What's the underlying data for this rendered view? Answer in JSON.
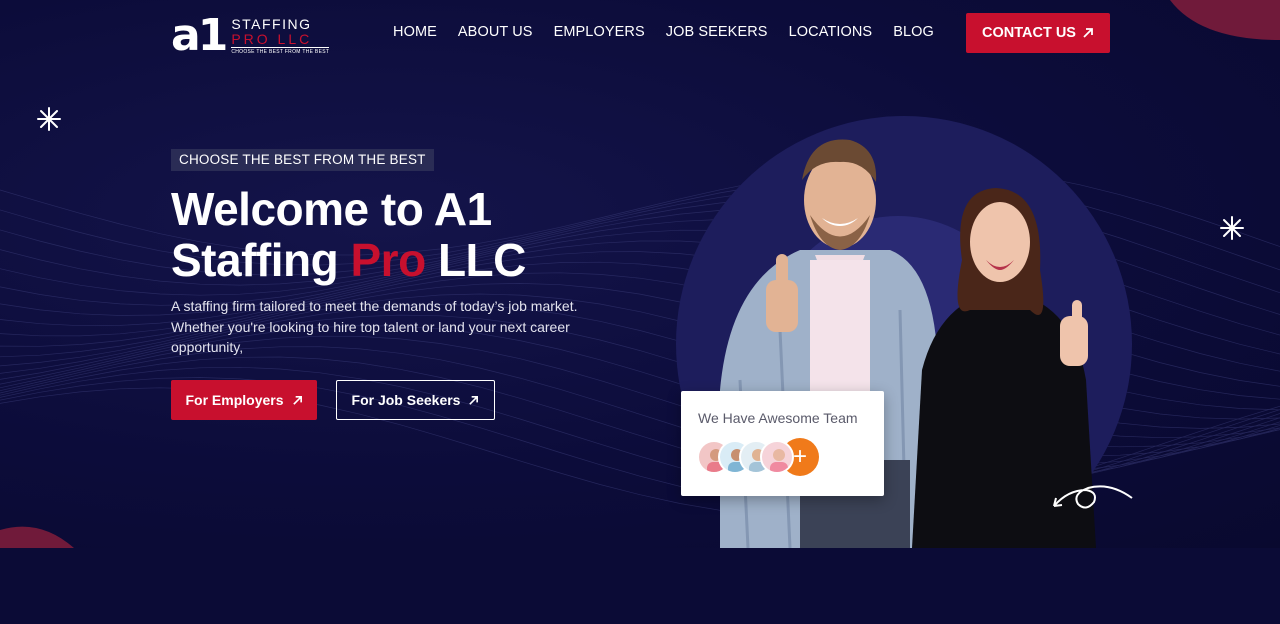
{
  "header": {
    "logo": {
      "mark": "a1",
      "line1": "STAFFING",
      "line2": "PRO LLC",
      "tagline": "CHOOSE THE BEST FROM THE BEST"
    },
    "nav": [
      {
        "label": "HOME",
        "name": "nav-home"
      },
      {
        "label": "ABOUT US",
        "name": "nav-about-us"
      },
      {
        "label": "EMPLOYERS",
        "name": "nav-employers"
      },
      {
        "label": "JOB SEEKERS",
        "name": "nav-job-seekers"
      },
      {
        "label": "LOCATIONS",
        "name": "nav-locations"
      },
      {
        "label": "BLOG",
        "name": "nav-blog"
      }
    ],
    "contact_label": "CONTACT US"
  },
  "hero": {
    "tag": "CHOOSE THE BEST FROM THE BEST",
    "headline_part1": "Welcome to A1",
    "headline_part2": "Staffing ",
    "headline_accent": "Pro",
    "headline_part3": " LLC",
    "description": "A staffing firm tailored to meet the demands of today’s job market. Whether you're looking to hire top talent or land your next career opportunity,",
    "btn_employers": "For Employers",
    "btn_job_seekers": "For Job Seekers"
  },
  "team_card": {
    "title": "We Have Awesome Team",
    "plus": "+"
  },
  "icons": {
    "arrow": "arrow-up-right-icon",
    "sparkle": "sparkle-icon"
  },
  "colors": {
    "brand_red": "#c8102e",
    "navy": "#0b0b38",
    "accent_orange": "#f07a1a"
  }
}
